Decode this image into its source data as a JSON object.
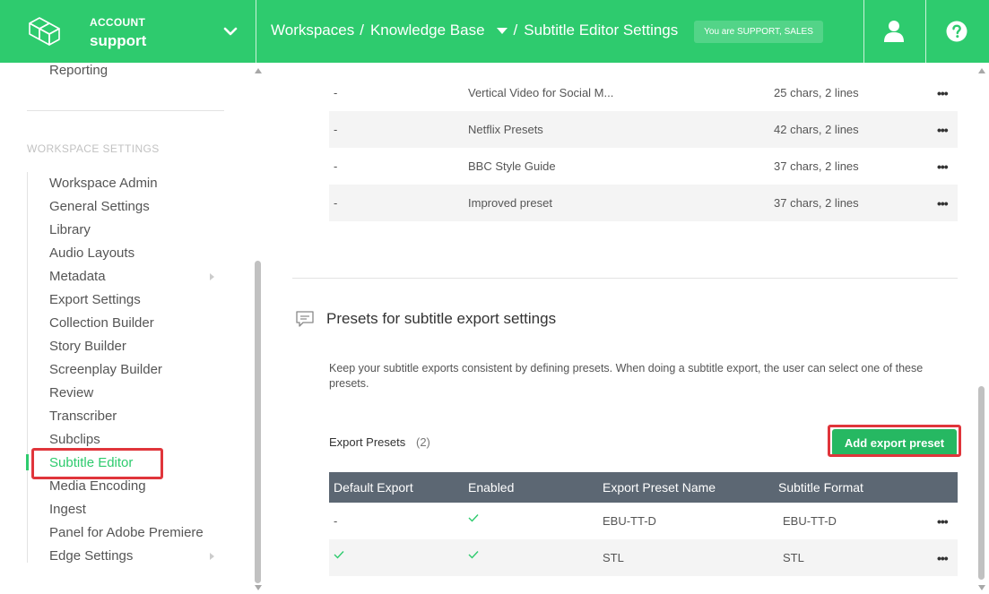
{
  "header": {
    "account_label": "ACCOUNT",
    "account_name": "support",
    "breadcrumb": [
      "Workspaces",
      "Knowledge Base",
      "Subtitle Editor Settings"
    ],
    "breadcrumb_sep": "/",
    "role_badge": "You are SUPPORT, SALES",
    "colors": {
      "brand": "#2ecb6e"
    }
  },
  "sidebar": {
    "top_item": "Reporting",
    "section_title": "WORKSPACE SETTINGS",
    "items": [
      {
        "label": "Workspace Admin"
      },
      {
        "label": "General Settings"
      },
      {
        "label": "Library"
      },
      {
        "label": "Audio Layouts"
      },
      {
        "label": "Metadata",
        "submenu": true
      },
      {
        "label": "Export Settings"
      },
      {
        "label": "Collection Builder"
      },
      {
        "label": "Story Builder"
      },
      {
        "label": "Screenplay Builder"
      },
      {
        "label": "Review"
      },
      {
        "label": "Transcriber"
      },
      {
        "label": "Subclips"
      },
      {
        "label": "Subtitle Editor",
        "active": true
      },
      {
        "label": "Media Encoding"
      },
      {
        "label": "Ingest"
      },
      {
        "label": "Panel for Adobe Premiere"
      },
      {
        "label": "Edge Settings",
        "submenu": true
      }
    ]
  },
  "editor_presets": {
    "rows": [
      {
        "default": "-",
        "name": "Vertical Video for Social M...",
        "limits": "25 chars, 2 lines",
        "menu": "•••"
      },
      {
        "default": "-",
        "name": "Netflix Presets",
        "limits": "42 chars, 2 lines",
        "menu": "•••"
      },
      {
        "default": "-",
        "name": "BBC Style Guide",
        "limits": "37 chars, 2 lines",
        "menu": "•••"
      },
      {
        "default": "-",
        "name": "Improved preset",
        "limits": "37 chars, 2 lines",
        "menu": "•••"
      }
    ]
  },
  "export_section": {
    "title": "Presets for subtitle export settings",
    "description": "Keep your subtitle exports consistent by defining presets. When doing a subtitle export, the user can select one of these presets.",
    "list_label": "Export Presets",
    "count": "(2)",
    "add_button": "Add export preset",
    "columns": [
      "Default Export",
      "Enabled",
      "Export Preset Name",
      "Subtitle Format"
    ],
    "rows": [
      {
        "default": "-",
        "default_check": false,
        "enabled": true,
        "name": "EBU-TT-D",
        "format": "EBU-TT-D",
        "menu": "•••"
      },
      {
        "default": "",
        "default_check": true,
        "enabled": true,
        "name": "STL",
        "format": "STL",
        "menu": "•••"
      }
    ]
  }
}
